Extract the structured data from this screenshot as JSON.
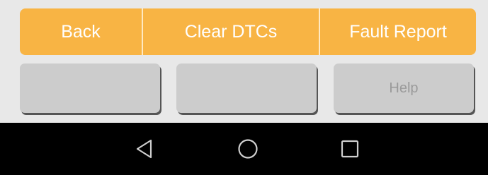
{
  "action_bar": {
    "back_label": "Back",
    "clear_dtcs_label": "Clear DTCs",
    "fault_report_label": "Fault Report",
    "color": "#F8B444"
  },
  "soft_keys": [
    {
      "label": ""
    },
    {
      "label": ""
    },
    {
      "label": "Help"
    }
  ],
  "system_nav": {
    "back_icon": "triangle-back-icon",
    "home_icon": "circle-home-icon",
    "recents_icon": "square-recents-icon"
  }
}
